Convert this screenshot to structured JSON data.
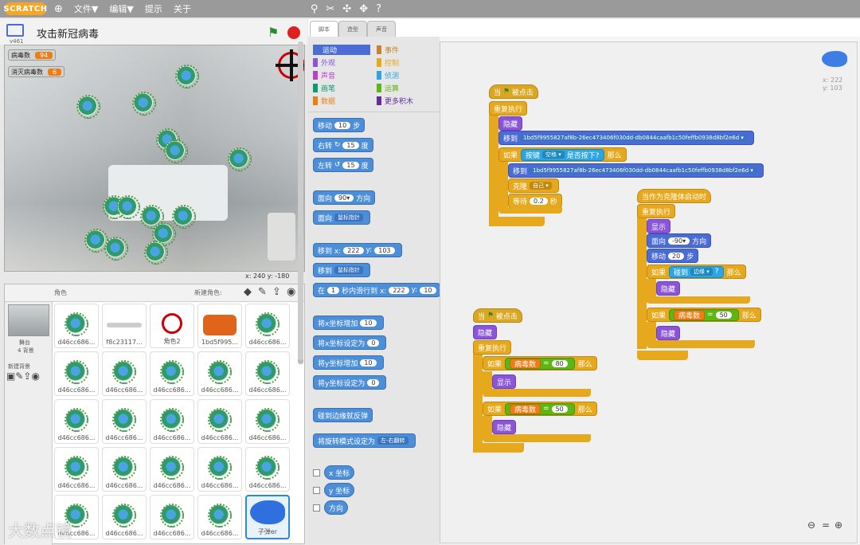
{
  "menu": {
    "logo": "SCRATCH",
    "file": "文件▼",
    "edit": "编辑▼",
    "tips": "提示",
    "about": "关于",
    "version": "v461"
  },
  "stage": {
    "title": "攻击新冠病毒",
    "coords": "x: 240  y: -180",
    "var1_label": "病毒数",
    "var1_value": "94",
    "var2_label": "消灭病毒数",
    "var2_value": "6"
  },
  "sprites": {
    "header": "角色",
    "new_sprite": "新建角色:",
    "stage_label": "舞台",
    "stage_sub": "4 背景",
    "new_bg": "新建背景",
    "items": [
      "d46cc686...",
      "f8c23117...",
      "角色2",
      "1bd5f995...",
      "d46cc686...",
      "d46cc686...",
      "d46cc686...",
      "d46cc686...",
      "d46cc686...",
      "d46cc686...",
      "d46cc686...",
      "d46cc686...",
      "d46cc686...",
      "d46cc686...",
      "d46cc686...",
      "d46cc686...",
      "d46cc686...",
      "d46cc686...",
      "d46cc686...",
      "d46cc686...",
      "d46cc686...",
      "d46cc686...",
      "d46cc686...",
      "d46cc686...",
      "子弹er"
    ]
  },
  "tabs": {
    "scripts": "脚本",
    "costumes": "造型",
    "sounds": "声音"
  },
  "categories": [
    {
      "label": "运动",
      "color": "#4a6cd4"
    },
    {
      "label": "事件",
      "color": "#c88330"
    },
    {
      "label": "外观",
      "color": "#8a55d7"
    },
    {
      "label": "控制",
      "color": "#e6a81c"
    },
    {
      "label": "声音",
      "color": "#bb42c3"
    },
    {
      "label": "侦测",
      "color": "#2ca5e2"
    },
    {
      "label": "画笔",
      "color": "#0e9a6c"
    },
    {
      "label": "运算",
      "color": "#5cb712"
    },
    {
      "label": "数据",
      "color": "#ee7d16"
    },
    {
      "label": "更多积木",
      "color": "#632d99"
    }
  ],
  "palette": {
    "move": "移动",
    "steps": "步",
    "move_val": "10",
    "turn_right": "右转",
    "turn_left": "左转",
    "deg": "度",
    "turn_val": "15",
    "point_dir": "面向",
    "dir_val": "90▾",
    "direction": "方向",
    "point_towards": "面向",
    "mouse_ptr": "鼠标指针",
    "goto_xy": "移到 x:",
    "x_val": "222",
    "y_lbl": "y:",
    "y_val": "103",
    "goto": "移到",
    "glide": "在",
    "glide_val": "1",
    "glide_txt": "秒内滑行到 x:",
    "glide_y": "10",
    "change_x": "将x坐标增加",
    "change_x_val": "10",
    "set_x": "将x坐标设定为",
    "set_x_val": "0",
    "change_y": "将y坐标增加",
    "change_y_val": "10",
    "set_y": "将y坐标设定为",
    "set_y_val": "0",
    "bounce": "碰到边缘就反弹",
    "rotation": "将旋转模式设定为",
    "rotation_val": "左-右翻转",
    "xpos": "x 坐标",
    "ypos": "y 坐标",
    "dir": "方向"
  },
  "script1": {
    "hat": "当",
    "hat2": "被点击",
    "forever": "重复执行",
    "hide": "隐藏",
    "goto": "移到",
    "goto_target": "1bd5f9955827af8b-26ec473406f030dd-db0844caafb1c50feffb0938d8bf2e6d ▾",
    "if": "如果",
    "key": "按键",
    "space": "空格 ▾",
    "pressed": "是否按下?",
    "then": "那么",
    "clone": "克隆",
    "self": "自己 ▾",
    "wait": "等待",
    "wait_val": "0.2",
    "secs": "秒"
  },
  "script2": {
    "hat": "当作为克隆体启动时",
    "forever": "重复执行",
    "show": "显示",
    "face": "面向",
    "face_val": "-90▾",
    "direction": "方向",
    "move": "移动",
    "move_val": "20",
    "steps": "步",
    "if": "如果",
    "touch": "碰到",
    "edge": "边缘 ▾",
    "q": "?",
    "then": "那么",
    "hide": "隐藏",
    "var": "病毒数",
    "eq": "=",
    "val50": "50"
  },
  "script3": {
    "hat": "当",
    "hat2": "被点击",
    "hide": "隐藏",
    "forever": "重复执行",
    "if": "如果",
    "var": "病毒数",
    "eq": "=",
    "val80": "80",
    "val50": "50",
    "then": "那么",
    "show": "显示",
    "hide2": "隐藏"
  },
  "sprite_info": {
    "x": "x: 222",
    "y": "y: 103"
  },
  "watermark": "大数点镜"
}
